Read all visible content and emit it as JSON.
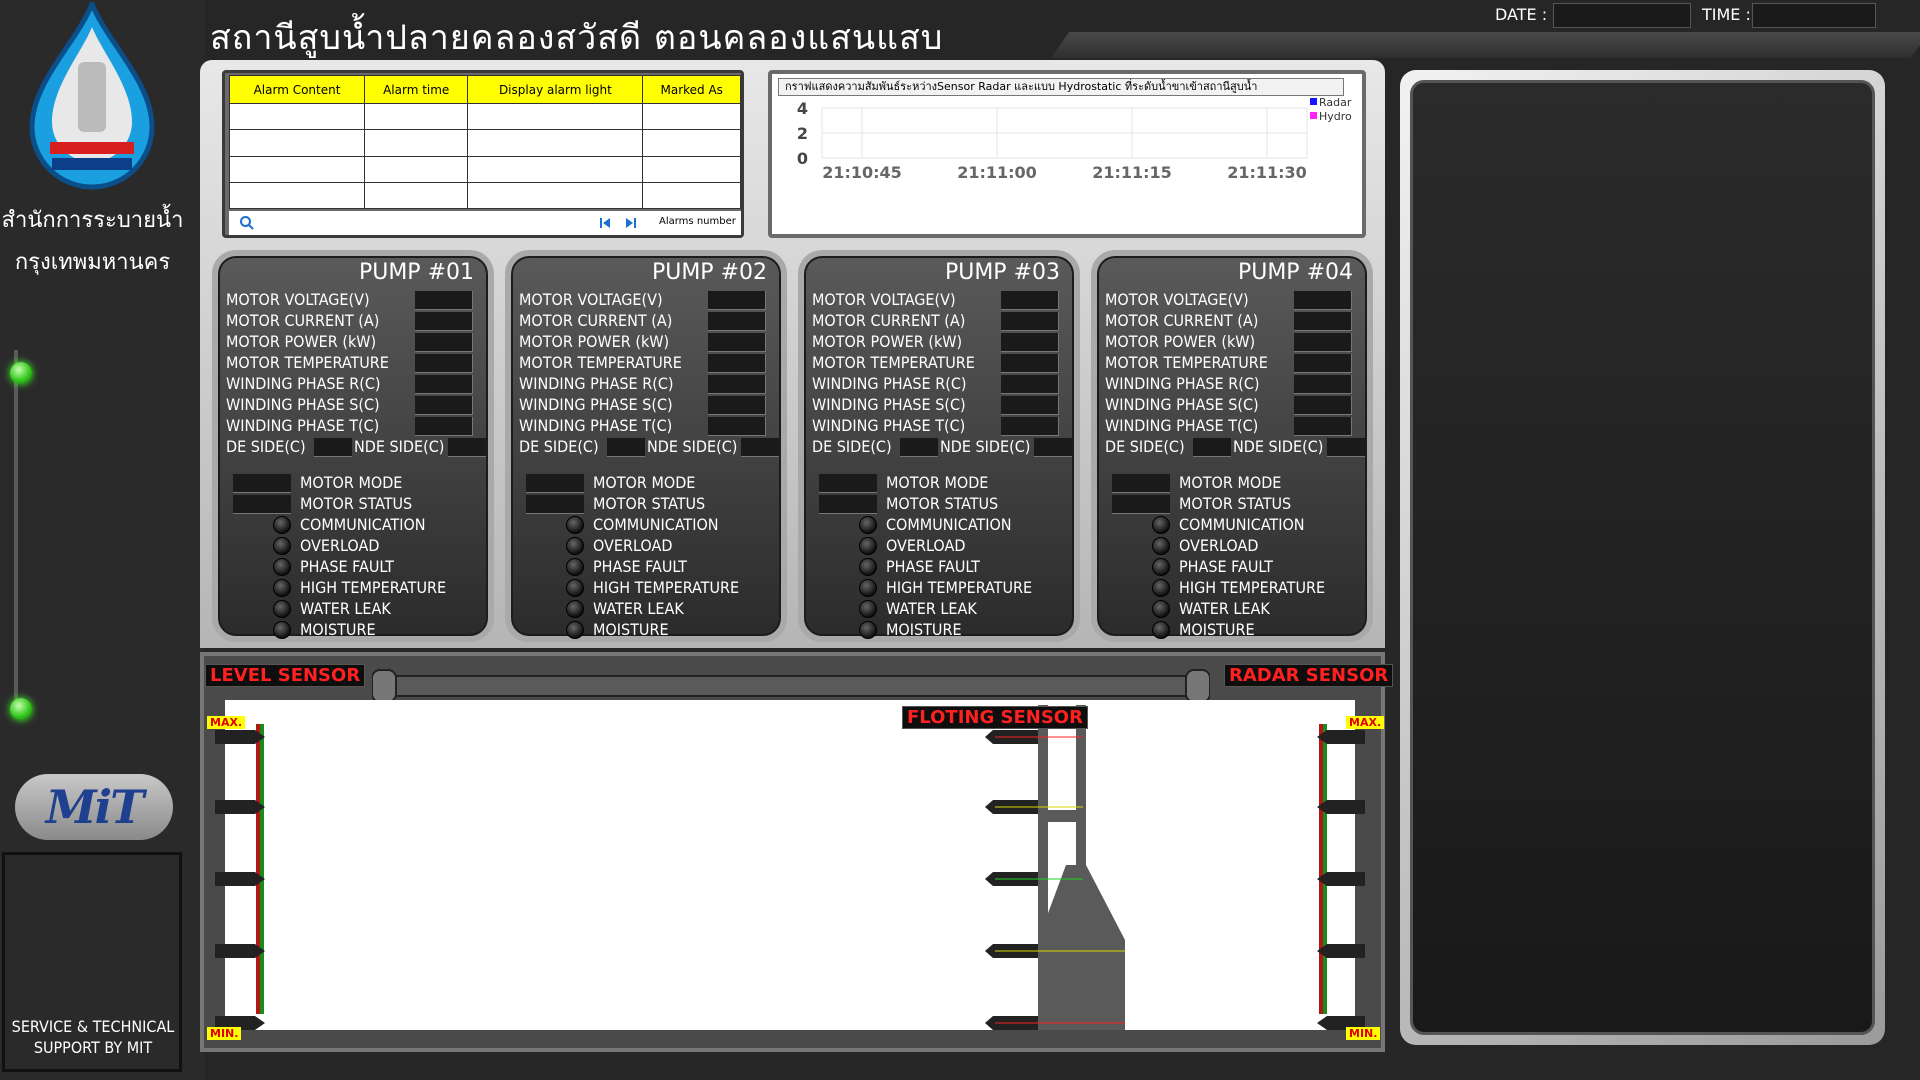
{
  "header": {
    "title": "สถานีสูบน้ำปลายคลองสวัสดี ตอนคลองแสนแสบ",
    "date_label": "DATE :",
    "date_value": "",
    "time_label": "TIME :",
    "time_value": ""
  },
  "sidebar": {
    "agency_line1": "สำนักการระบายน้ำ",
    "agency_line2": "กรุงเทพมหานคร",
    "logo_text": "MiT",
    "support_line1": "SERVICE & TECHNICAL",
    "support_line2": "SUPPORT BY MIT"
  },
  "alarm_panel": {
    "columns": [
      "Alarm Content",
      "Alarm time",
      "Display alarm light",
      "Marked As"
    ],
    "rows": [
      [
        "",
        "",
        "",
        ""
      ],
      [
        "",
        "",
        "",
        ""
      ],
      [
        "",
        "",
        "",
        ""
      ],
      [
        "",
        "",
        "",
        ""
      ]
    ],
    "footer_label": "Alarms number"
  },
  "trend": {
    "title": "กราฟแสดงความสัมพันธ์ระหว่างSensor Radar และแบบ Hydrostatic ที่ระดับน้ำขาเข้าสถานีสูบน้ำ",
    "legend": [
      {
        "name": "Radar",
        "color": "#1515ff"
      },
      {
        "name": "Hydro",
        "color": "#ff22ff"
      }
    ]
  },
  "chart_data": {
    "type": "line",
    "title": "กราฟแสดงความสัมพันธ์ระหว่างSensor Radar และแบบ Hydrostatic ที่ระดับน้ำขาเข้าสถานีสูบน้ำ",
    "x_ticks": [
      "21:10:45",
      "21:11:00",
      "21:11:15",
      "21:11:30"
    ],
    "y_ticks": [
      0,
      2,
      4
    ],
    "ylim": [
      0,
      4
    ],
    "grid": true,
    "legend_position": "top-right",
    "series": [
      {
        "name": "Radar",
        "values": []
      },
      {
        "name": "Hydro",
        "values": []
      }
    ]
  },
  "pump_labels": {
    "voltage": "MOTOR  VOLTAGE(V)",
    "current": "MOTOR CURRENT (A)",
    "power": "MOTOR POWER (kW)",
    "temperature": "MOTOR TEMPERATURE",
    "winding_r": "WINDING PHASE R(C)",
    "winding_s": "WINDING PHASE S(C)",
    "winding_t": "WINDING PHASE T(C)",
    "de_side": "DE SIDE(C)",
    "nde_side": "NDE SIDE(C)",
    "motor_mode": "MOTOR MODE",
    "motor_status": "MOTOR STATUS",
    "communication": "COMMUNICATION",
    "overload": "OVERLOAD",
    "phase_fault": "PHASE FAULT",
    "high_temperature": "HIGH TEMPERATURE",
    "water_leak": "WATER LEAK",
    "moisture": "MOISTURE"
  },
  "pumps": [
    {
      "title": "PUMP #01"
    },
    {
      "title": "PUMP #02"
    },
    {
      "title": "PUMP #03"
    },
    {
      "title": "PUMP #04"
    }
  ],
  "sensors": {
    "level_label": "LEVEL SENSOR",
    "radar_label": "RADAR SENSOR",
    "floating_label": "FLOTING SENSOR",
    "max_label": "MAX.",
    "min_label": "MIN."
  }
}
